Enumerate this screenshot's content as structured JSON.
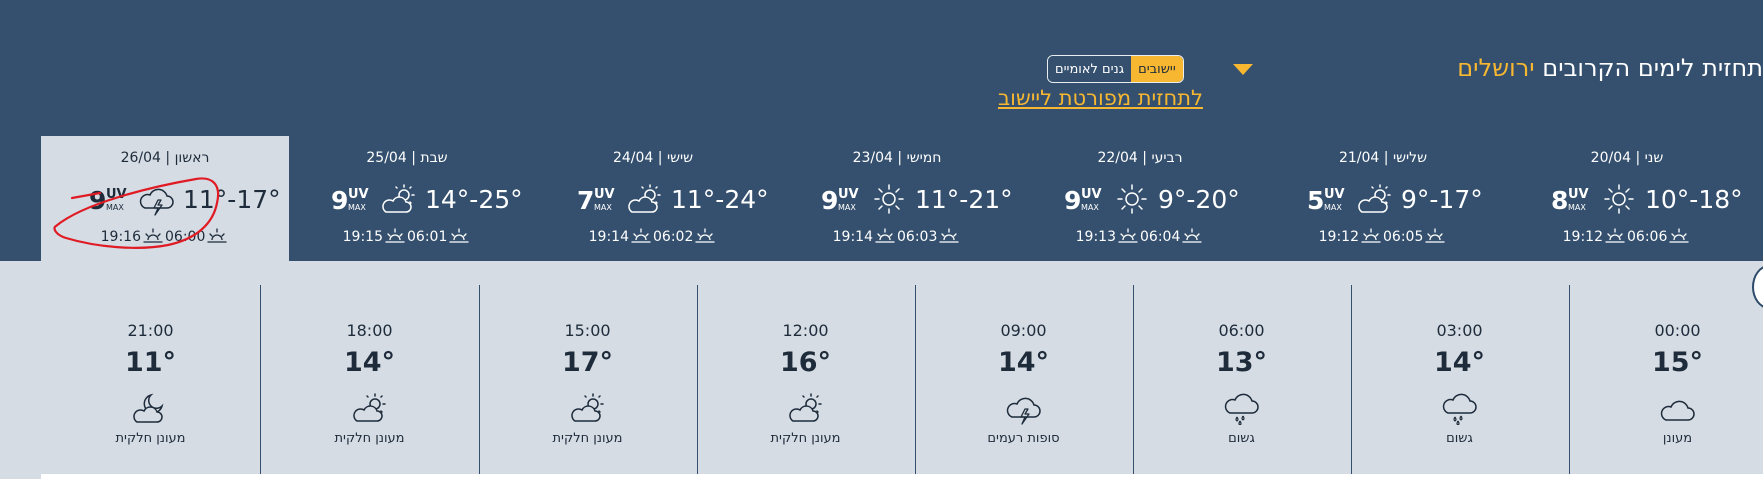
{
  "header": {
    "title_text": "תחזית לימים הקרובים",
    "city": "ירושלים",
    "toggle_left": "גנים לאומיים",
    "toggle_right": "יישובים",
    "detailed_link": "לתחזית מפורטת ליישוב"
  },
  "days": [
    {
      "name": "ראשון",
      "date": "26/04",
      "uv": "9",
      "temp": "11°-17°",
      "sunset": "19:16",
      "sunrise": "06:00",
      "icon": "cloud-lightning-icon"
    },
    {
      "name": "שבת",
      "date": "25/04",
      "uv": "9",
      "temp": "14°-25°",
      "sunset": "19:15",
      "sunrise": "06:01",
      "icon": "partly-cloudy-icon"
    },
    {
      "name": "שישי",
      "date": "24/04",
      "uv": "7",
      "temp": "11°-24°",
      "sunset": "19:14",
      "sunrise": "06:02",
      "icon": "partly-cloudy-icon"
    },
    {
      "name": "חמישי",
      "date": "23/04",
      "uv": "9",
      "temp": "11°-21°",
      "sunset": "19:14",
      "sunrise": "06:03",
      "icon": "sun-icon"
    },
    {
      "name": "רביעי",
      "date": "22/04",
      "uv": "9",
      "temp": "9°-20°",
      "sunset": "19:13",
      "sunrise": "06:04",
      "icon": "sun-icon"
    },
    {
      "name": "שלישי",
      "date": "21/04",
      "uv": "5",
      "temp": "9°-17°",
      "sunset": "19:12",
      "sunrise": "06:05",
      "icon": "partly-cloudy-icon"
    },
    {
      "name": "שני",
      "date": "20/04",
      "uv": "8",
      "temp": "10°-18°",
      "sunset": "19:12",
      "sunrise": "06:06",
      "icon": "sun-icon"
    }
  ],
  "uv_label": "UV",
  "uv_max_label": "MAX",
  "hours": [
    {
      "time": "21:00",
      "temp": "11°",
      "condition": "מעונן חלקית",
      "icon": "moon-cloud-icon"
    },
    {
      "time": "18:00",
      "temp": "14°",
      "condition": "מעונן חלקית",
      "icon": "partly-cloudy-icon"
    },
    {
      "time": "15:00",
      "temp": "17°",
      "condition": "מעונן חלקית",
      "icon": "partly-cloudy-icon"
    },
    {
      "time": "12:00",
      "temp": "16°",
      "condition": "מעונן חלקית",
      "icon": "partly-cloudy-icon"
    },
    {
      "time": "09:00",
      "temp": "14°",
      "condition": "סופות רעמים",
      "icon": "cloud-lightning-icon"
    },
    {
      "time": "06:00",
      "temp": "13°",
      "condition": "גשום",
      "icon": "rain-cloud-icon"
    },
    {
      "time": "03:00",
      "temp": "14°",
      "condition": "גשום",
      "icon": "rain-cloud-icon"
    },
    {
      "time": "00:00",
      "temp": "15°",
      "condition": "מעונן",
      "icon": "cloud-icon"
    }
  ],
  "colors": {
    "background": "#34506e",
    "accent": "#f7b731",
    "panel": "#d5dce4",
    "annotation": "#e01b24"
  }
}
